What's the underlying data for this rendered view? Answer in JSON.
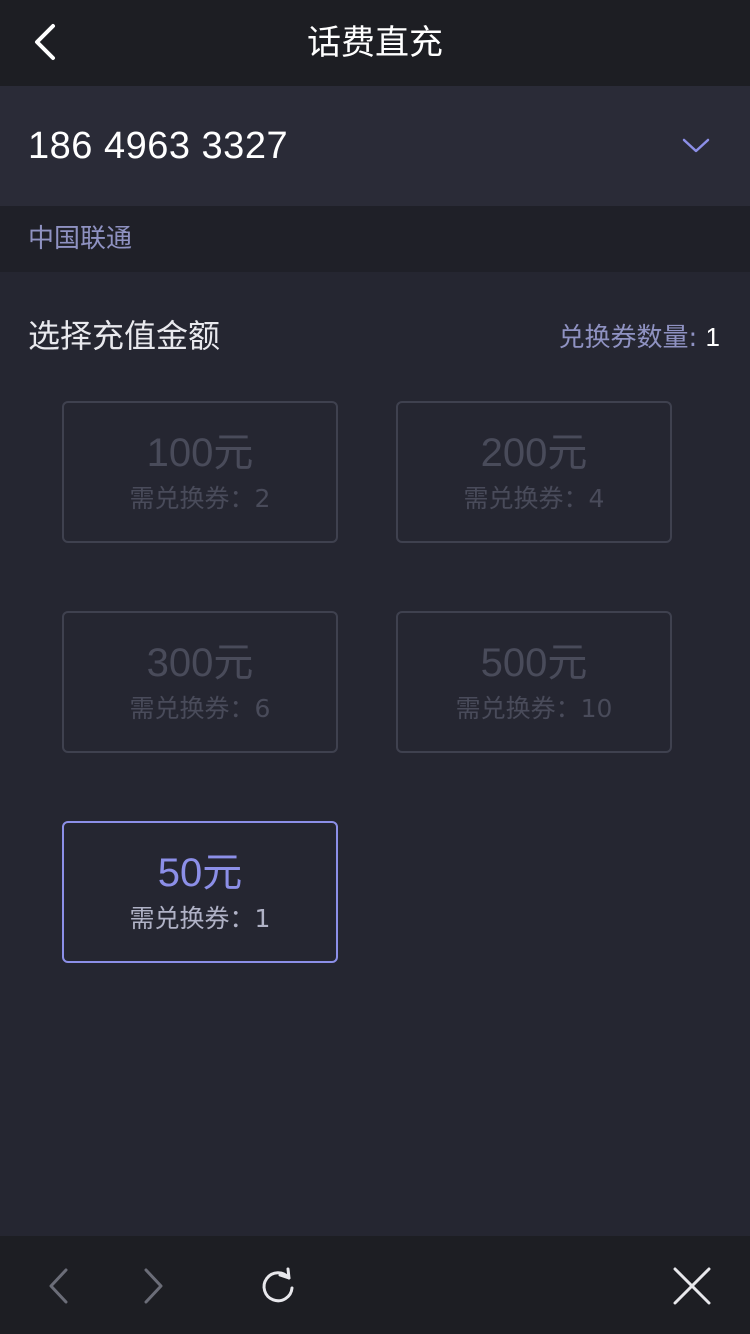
{
  "header": {
    "title": "话费直充",
    "back_icon": "chevron-left-icon"
  },
  "phone": {
    "number": "186 4963 3327",
    "dropdown_icon": "chevron-down-icon"
  },
  "carrier": {
    "name": "中国联通"
  },
  "section": {
    "title": "选择充值金额",
    "voucher_label": "兑换券数量: ",
    "voucher_count": "1"
  },
  "options": [
    {
      "amount": "100元",
      "need": "需兑换券：2",
      "state": "disabled"
    },
    {
      "amount": "200元",
      "need": "需兑换券：4",
      "state": "disabled"
    },
    {
      "amount": "300元",
      "need": "需兑换券：6",
      "state": "disabled"
    },
    {
      "amount": "500元",
      "need": "需兑换券：10",
      "state": "disabled"
    },
    {
      "amount": "50元",
      "need": "需兑换券：1",
      "state": "selected"
    }
  ],
  "browser_bar": {
    "icons": [
      "chevron-left-icon",
      "chevron-right-icon",
      "refresh-icon",
      "close-icon"
    ]
  },
  "colors": {
    "accent": "#8c8fe8",
    "background": "#252631",
    "bar": "#1d1e23"
  }
}
